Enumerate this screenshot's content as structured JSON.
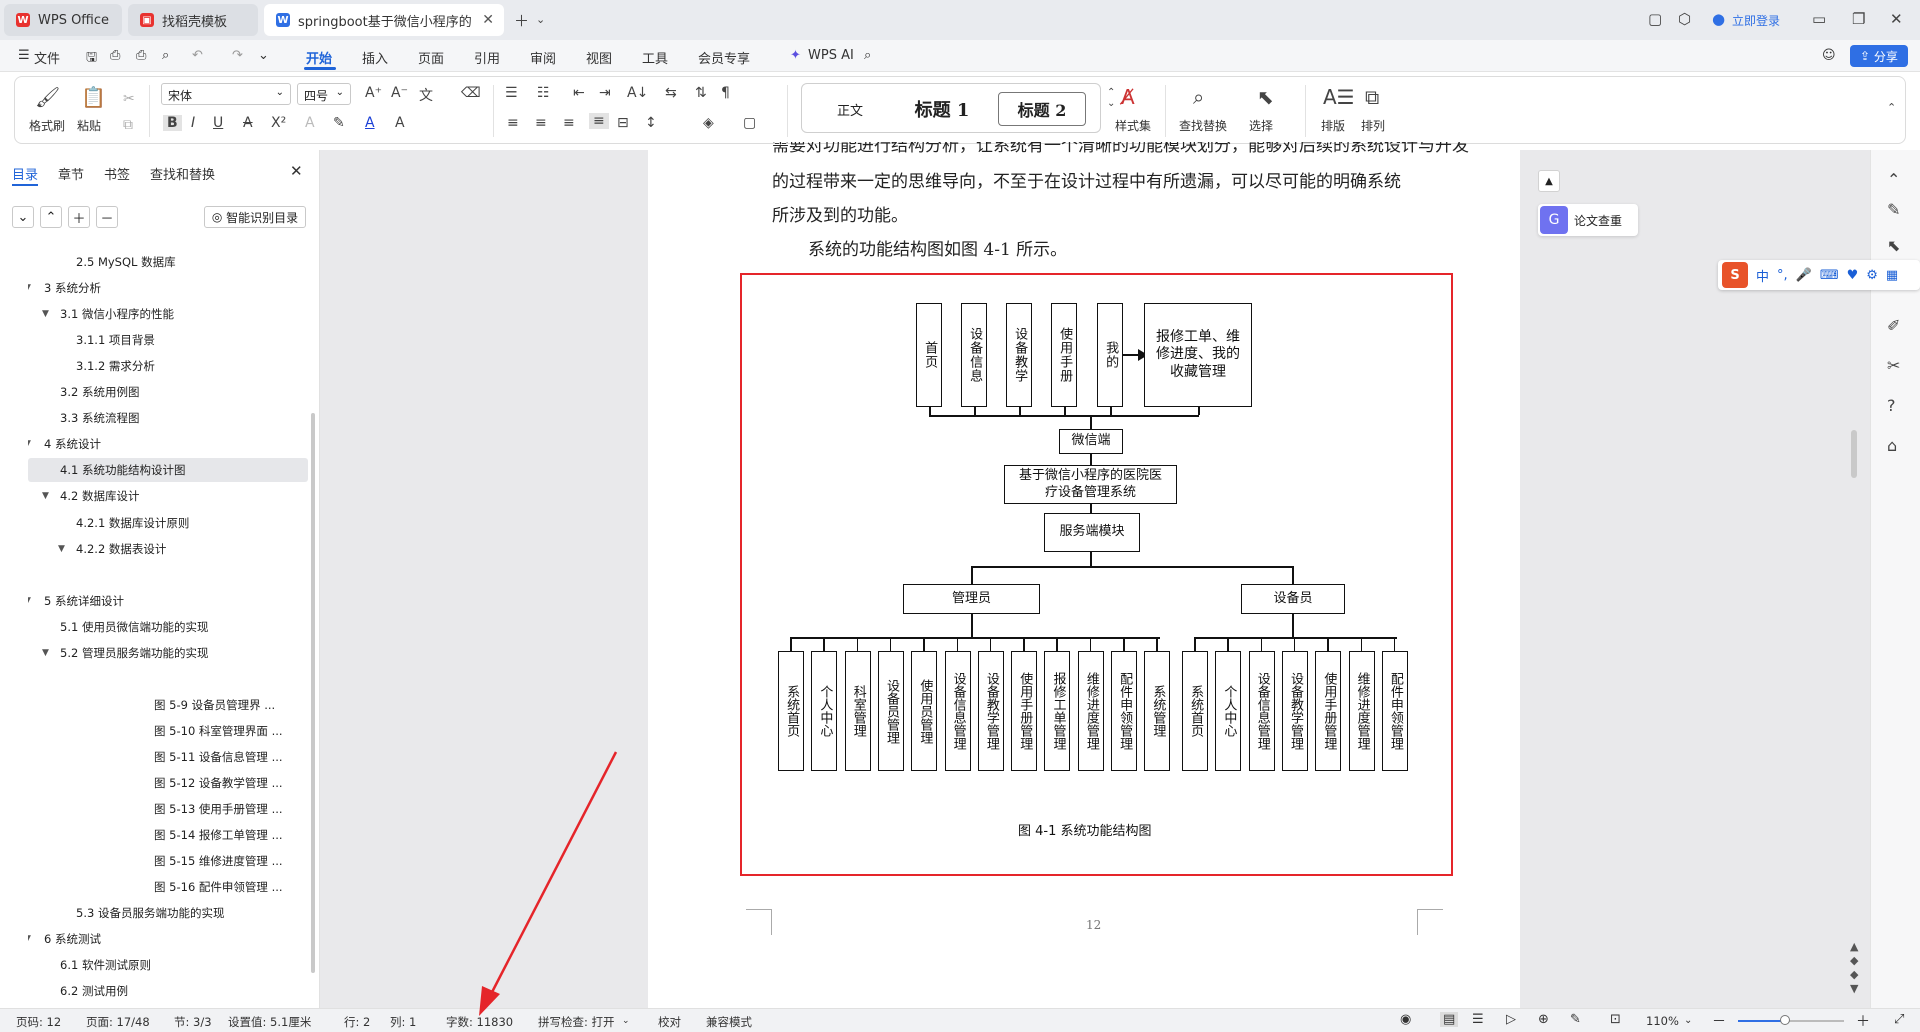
{
  "tabs": [
    {
      "label": "WPS Office",
      "icon": "wps-logo-icon",
      "color": "#e8322f"
    },
    {
      "label": "找稻壳模板",
      "icon": "docer-icon",
      "color": "#e8322f"
    },
    {
      "label": "springboot基于微信小程序的",
      "icon": "word-doc-icon",
      "color": "#2f6fe4"
    }
  ],
  "login_label": "立即登录",
  "menu": {
    "file": "文件",
    "items": [
      "开始",
      "插入",
      "页面",
      "引用",
      "审阅",
      "视图",
      "工具",
      "会员专享"
    ],
    "ai": "WPS AI",
    "share": "分享"
  },
  "ribbon": {
    "format_painter": "格式刷",
    "paste": "粘贴",
    "font_name": "宋体",
    "font_size": "四号",
    "styles": [
      "正文",
      "标题 1",
      "标题 2"
    ],
    "style_set": "样式集",
    "find_replace": "查找替换",
    "select": "选择",
    "layout": "排版",
    "arrange": "排列"
  },
  "nav": {
    "tabs": [
      "目录",
      "章节",
      "书签",
      "查找和替换"
    ],
    "smart_toc": "智能识别目录",
    "items": [
      {
        "label": "2.5 MySQL 数据库",
        "level": 3,
        "arrow": "",
        "active": false
      },
      {
        "label": "3 系统分析",
        "level": 1,
        "arrow": "▼",
        "active": false
      },
      {
        "label": "3.1 微信小程序的性能",
        "level": 2,
        "arrow": "▼",
        "active": false
      },
      {
        "label": "3.1.1 项目背景",
        "level": 3,
        "arrow": "",
        "active": false
      },
      {
        "label": "3.1.2 需求分析",
        "level": 3,
        "arrow": "",
        "active": false
      },
      {
        "label": "3.2 系统用例图",
        "level": 2,
        "arrow": "",
        "active": false
      },
      {
        "label": "3.3  系统流程图",
        "level": 2,
        "arrow": "",
        "active": false
      },
      {
        "label": "4  系统设计",
        "level": 1,
        "arrow": "▼",
        "active": false
      },
      {
        "label": "4.1 系统功能结构设计图",
        "level": 2,
        "arrow": "",
        "active": true
      },
      {
        "label": "4.2 数据库设计",
        "level": 2,
        "arrow": "▼",
        "active": false
      },
      {
        "label": "4.2.1 数据库设计原则",
        "level": 3,
        "arrow": "",
        "active": false
      },
      {
        "label": "4.2.2    数据表设计",
        "level": 3,
        "arrow": "▼",
        "active": false
      },
      {
        "label": "",
        "level": 1,
        "arrow": "",
        "active": false
      },
      {
        "label": "5 系统详细设计",
        "level": 1,
        "arrow": "▼",
        "active": false
      },
      {
        "label": "5.1 使用员微信端功能的实现",
        "level": 2,
        "arrow": "",
        "active": false
      },
      {
        "label": "5.2  管理员服务端功能的实现",
        "level": 2,
        "arrow": "▼",
        "active": false
      },
      {
        "label": "",
        "level": 1,
        "arrow": "",
        "active": false
      },
      {
        "label": "图 5-9 设备员管理界 ...",
        "level": 4,
        "arrow": "",
        "active": false
      },
      {
        "label": "图 5-10 科室管理界面 ...",
        "level": 4,
        "arrow": "",
        "active": false
      },
      {
        "label": "图 5-11 设备信息管理 ...",
        "level": 4,
        "arrow": "",
        "active": false
      },
      {
        "label": "图 5-12 设备教学管理 ...",
        "level": 4,
        "arrow": "",
        "active": false
      },
      {
        "label": "图 5-13 使用手册管理 ...",
        "level": 4,
        "arrow": "",
        "active": false
      },
      {
        "label": "图 5-14 报修工单管理 ...",
        "level": 4,
        "arrow": "",
        "active": false
      },
      {
        "label": "图 5-15 维修进度管理 ...",
        "level": 4,
        "arrow": "",
        "active": false
      },
      {
        "label": "图 5-16 配件申领管理 ...",
        "level": 4,
        "arrow": "",
        "active": false
      },
      {
        "label": "5.3  设备员服务端功能的实现",
        "level": 3,
        "arrow": "",
        "active": false
      },
      {
        "label": "6  系统测试",
        "level": 1,
        "arrow": "▼",
        "active": false
      },
      {
        "label": "6.1 软件测试原则",
        "level": 2,
        "arrow": "",
        "active": false
      },
      {
        "label": "6.2 测试用例",
        "level": 2,
        "arrow": "",
        "active": false
      }
    ]
  },
  "doc": {
    "line0": "需要对功能进行结构分析，让系统有一个清晰的功能模块划分，能够对后续的系统设计与开发",
    "line1": "的过程带来一定的思维导向，不至于在设计过程中有所遗漏，可以尽可能的明确系统",
    "line2": "所涉及到的功能。",
    "line3": "系统的功能结构图如图 4-1 所示。",
    "diagram": {
      "top_boxes": [
        "首页",
        "设备信息",
        "设备教学",
        "使用手册",
        "我的"
      ],
      "my_detail": "报修工单、维修进度、我的收藏管理",
      "wechat": "微信端",
      "system": "基于微信小程序的医院医疗设备管理系统",
      "server": "服务端模块",
      "admin": "管理员",
      "device_staff": "设备员",
      "admin_items": [
        "系统首页",
        "个人中心",
        "科室管理",
        "设备员管理",
        "使用员管理",
        "设备信息管理",
        "设备教学管理",
        "使用手册管理",
        "报修工单管理",
        "维修进度管理",
        "配件申领管理",
        "系统管理"
      ],
      "staff_items": [
        "系统首页",
        "个人中心",
        "设备信息管理",
        "设备教学管理",
        "使用手册管理",
        "维修进度管理",
        "配件申领管理"
      ]
    },
    "caption": "图 4-1 系统功能结构图",
    "page_number": "12"
  },
  "side": {
    "paper_check": "论文查重",
    "ime": "中"
  },
  "status": {
    "page_no": "页码: 12",
    "page": "页面: 17/48",
    "section": "节: 3/3",
    "setting": "设置值: 5.1厘米",
    "row": "行: 2",
    "col": "列: 1",
    "words": "字数: 11830",
    "spell": "拼写检查: 打开",
    "proof": "校对",
    "compat": "兼容模式",
    "zoom": "110%",
    "zoom_fraction": 0.44
  },
  "colors": {
    "accent": "#2064d8",
    "highlight_box": "#e5252a",
    "annotation_arrow": "#e5252a"
  }
}
